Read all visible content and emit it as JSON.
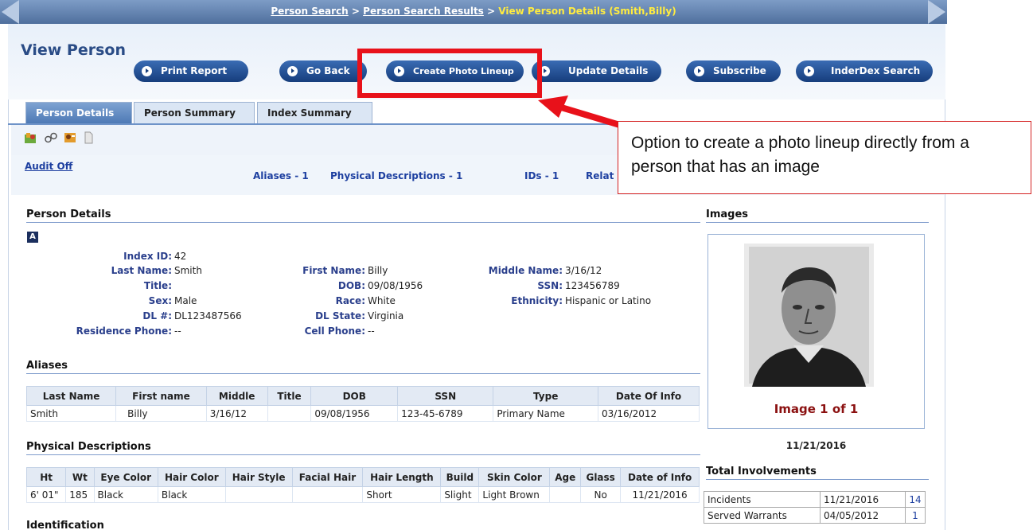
{
  "breadcrumb": {
    "items": [
      "Person Search",
      "Person Search Results"
    ],
    "separator": ">",
    "current": "View Person Details (Smith,Billy)"
  },
  "page_title": "View Person",
  "toolbar": {
    "buttons": [
      "Print Report",
      "Go Back",
      "Create Photo Lineup",
      "Update Details",
      "Subscribe",
      "InderDex Search"
    ]
  },
  "tabs": [
    "Person Details",
    "Person Summary",
    "Index Summary"
  ],
  "active_tab": "Person Details",
  "icons": [
    "map-people-icon",
    "handcuffs-icon",
    "person-card-icon",
    "document-icon"
  ],
  "subnav": {
    "audit": "Audit Off",
    "links": [
      "Aliases - 1",
      "Physical Descriptions - 1",
      "IDs - 1",
      "Relat"
    ]
  },
  "callout": {
    "text": "Option to create a photo lineup directly from a person that has an image"
  },
  "person_details": {
    "heading": "Person Details",
    "fields": {
      "index_id": {
        "label": "Index ID:",
        "value": "42"
      },
      "last_name": {
        "label": "Last Name:",
        "value": "Smith"
      },
      "first_name": {
        "label": "First Name:",
        "value": "Billy"
      },
      "middle_name": {
        "label": "Middle Name:",
        "value": "3/16/12"
      },
      "title": {
        "label": "Title:",
        "value": ""
      },
      "dob": {
        "label": "DOB:",
        "value": "09/08/1956"
      },
      "ssn": {
        "label": "SSN:",
        "value": "123456789"
      },
      "sex": {
        "label": "Sex:",
        "value": "Male"
      },
      "race": {
        "label": "Race:",
        "value": "White"
      },
      "ethnicity": {
        "label": "Ethnicity:",
        "value": "Hispanic or Latino"
      },
      "dl": {
        "label": "DL #:",
        "value": "DL123487566"
      },
      "dl_state": {
        "label": "DL State:",
        "value": "Virginia"
      },
      "residence_phone": {
        "label": "Residence Phone:",
        "value": "--"
      },
      "cell_phone": {
        "label": "Cell Phone:",
        "value": "--"
      }
    }
  },
  "aliases": {
    "heading": "Aliases",
    "columns": [
      "Last Name",
      "First name",
      "Middle",
      "Title",
      "DOB",
      "SSN",
      "Type",
      "Date Of Info"
    ],
    "rows": [
      [
        "Smith",
        "Billy",
        "3/16/12",
        "",
        "09/08/1956",
        "123-45-6789",
        "Primary Name",
        "03/16/2012"
      ]
    ]
  },
  "physical": {
    "heading": "Physical Descriptions",
    "columns": [
      "Ht",
      "Wt",
      "Eye Color",
      "Hair Color",
      "Hair Style",
      "Facial Hair",
      "Hair Length",
      "Build",
      "Skin Color",
      "Age",
      "Glass",
      "Date of Info"
    ],
    "rows": [
      [
        "6' 01\"",
        "185",
        "Black",
        "Black",
        "",
        "",
        "Short",
        "Slight",
        "Light Brown",
        "",
        "No",
        "11/21/2016"
      ]
    ]
  },
  "identification": {
    "heading": "Identification"
  },
  "images": {
    "heading": "Images",
    "caption": "Image 1 of 1",
    "date": "11/21/2016"
  },
  "involvements": {
    "heading": "Total Involvements",
    "rows": [
      {
        "label": "Incidents",
        "date": "11/21/2016",
        "count": "14"
      },
      {
        "label": "Served Warrants",
        "date": "04/05/2012",
        "count": "1"
      }
    ]
  },
  "colors": {
    "accent": "#2a4c86",
    "button": "#163d7c",
    "highlight_red": "#e8111a",
    "breadcrumb_current": "#ffec40",
    "image_caption": "#8b1010"
  }
}
